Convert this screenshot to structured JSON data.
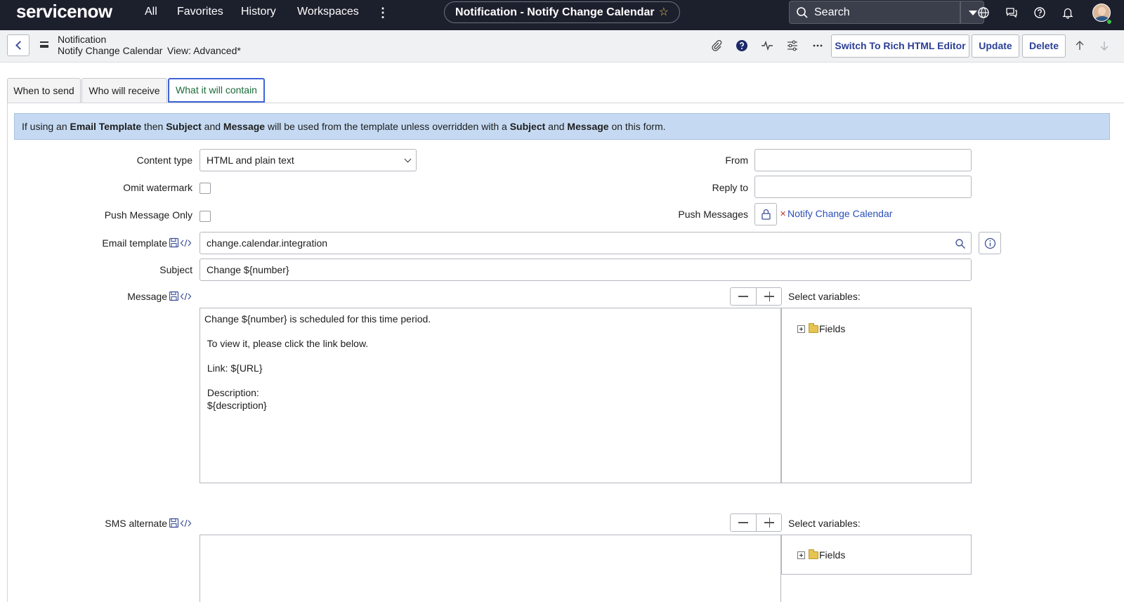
{
  "topnav": {
    "logo": "servicenow",
    "links": [
      "All",
      "Favorites",
      "History",
      "Workspaces"
    ],
    "title": "Notification - Notify Change Calendar",
    "search_label": "Search"
  },
  "header": {
    "record_type": "Notification",
    "record_name": "Notify Change Calendar",
    "view": "View: Advanced*",
    "buttons": {
      "rich_editor": "Switch To Rich HTML Editor",
      "update": "Update",
      "delete": "Delete"
    }
  },
  "tabs": [
    "When to send",
    "Who will receive",
    "What it will contain"
  ],
  "info": {
    "p1": "If using an ",
    "b1": "Email Template",
    "p2": " then ",
    "b2": "Subject",
    "p3": " and ",
    "b3": "Message",
    "p4": " will be used from the template unless overridden with a ",
    "b4": "Subject",
    "p5": " and ",
    "b5": "Message",
    "p6": " on this form."
  },
  "form": {
    "content_type_label": "Content type",
    "content_type_value": "HTML and plain text",
    "omit_watermark_label": "Omit watermark",
    "push_only_label": "Push Message Only",
    "from_label": "From",
    "from_value": "",
    "reply_to_label": "Reply to",
    "reply_to_value": "",
    "push_messages_label": "Push Messages",
    "push_messages_value": "Notify Change Calendar",
    "email_template_label": "Email template",
    "email_template_value": "change.calendar.integration",
    "subject_label": "Subject",
    "subject_value": "Change ${number}",
    "message_label": "Message",
    "message_lines": [
      "Change ${number} is scheduled for this time period.",
      "",
      " To view it, please click the link below.",
      "",
      " Link: ${URL}",
      "",
      " Description:",
      " ${description}"
    ],
    "select_variables_label": "Select variables:",
    "fields_label": "Fields",
    "sms_label": "SMS alternate"
  }
}
